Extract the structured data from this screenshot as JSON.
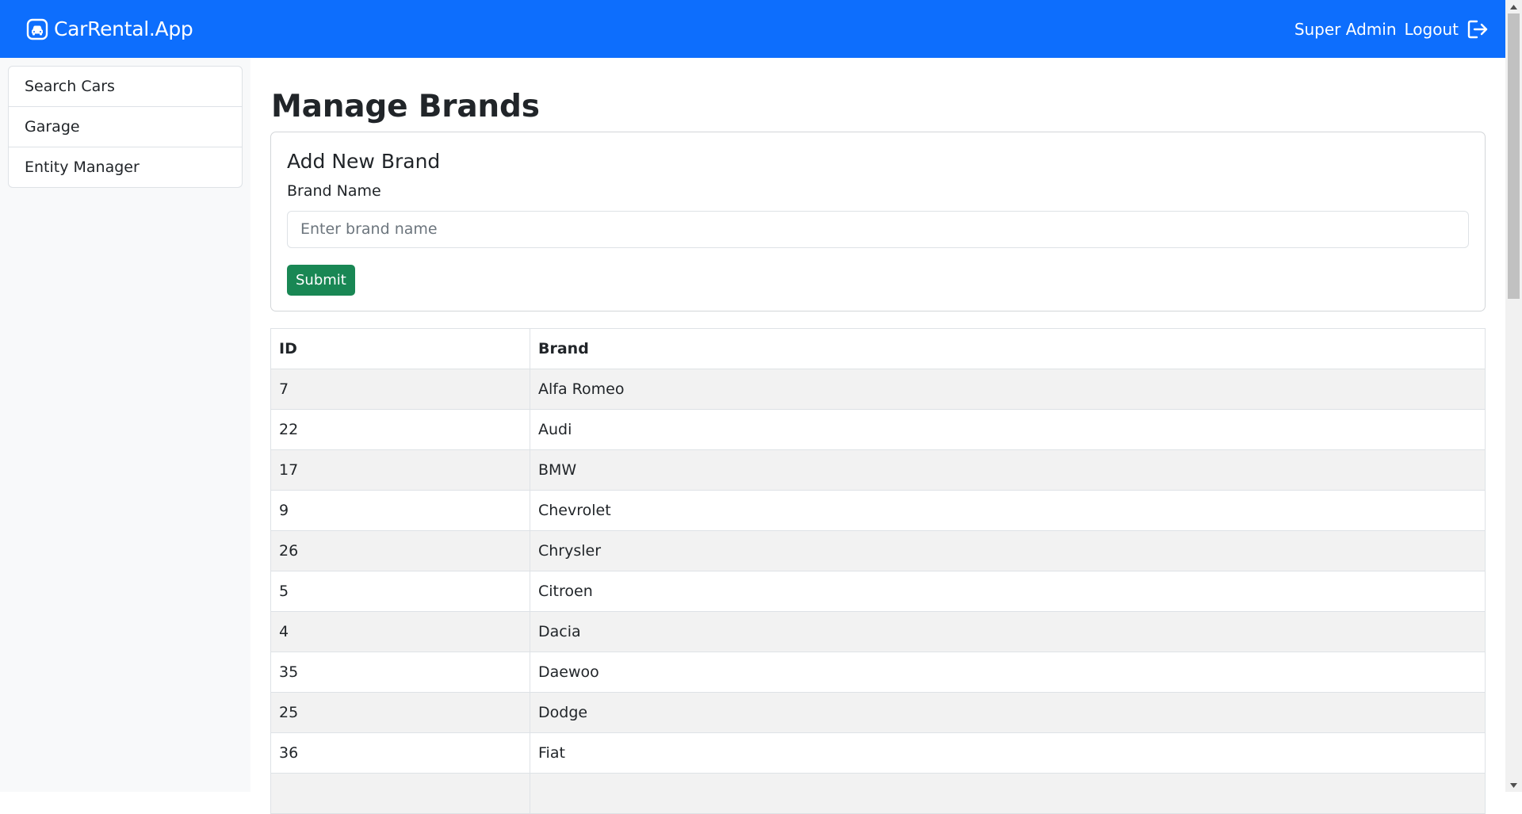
{
  "app": {
    "brand": "CarRental.App",
    "brand_icon": "car-front-icon",
    "accent_color": "#0d6efd",
    "user": "Super Admin",
    "logout_label": "Logout",
    "logout_icon": "box-arrow-right-icon"
  },
  "sidebar": {
    "items": [
      {
        "label": "Search Cars"
      },
      {
        "label": "Garage"
      },
      {
        "label": "Entity Manager"
      }
    ]
  },
  "main": {
    "title": "Manage Brands",
    "form": {
      "title": "Add New Brand",
      "field_label": "Brand Name",
      "placeholder": "Enter brand name",
      "value": "",
      "submit_label": "Submit",
      "submit_color": "#198754"
    },
    "table": {
      "headers": [
        "ID",
        "Brand"
      ],
      "rows": [
        {
          "id": "7",
          "brand": "Alfa Romeo"
        },
        {
          "id": "22",
          "brand": "Audi"
        },
        {
          "id": "17",
          "brand": "BMW"
        },
        {
          "id": "9",
          "brand": "Chevrolet"
        },
        {
          "id": "26",
          "brand": "Chrysler"
        },
        {
          "id": "5",
          "brand": "Citroen"
        },
        {
          "id": "4",
          "brand": "Dacia"
        },
        {
          "id": "35",
          "brand": "Daewoo"
        },
        {
          "id": "25",
          "brand": "Dodge"
        },
        {
          "id": "36",
          "brand": "Fiat"
        },
        {
          "id": "",
          "brand": ""
        }
      ]
    }
  }
}
